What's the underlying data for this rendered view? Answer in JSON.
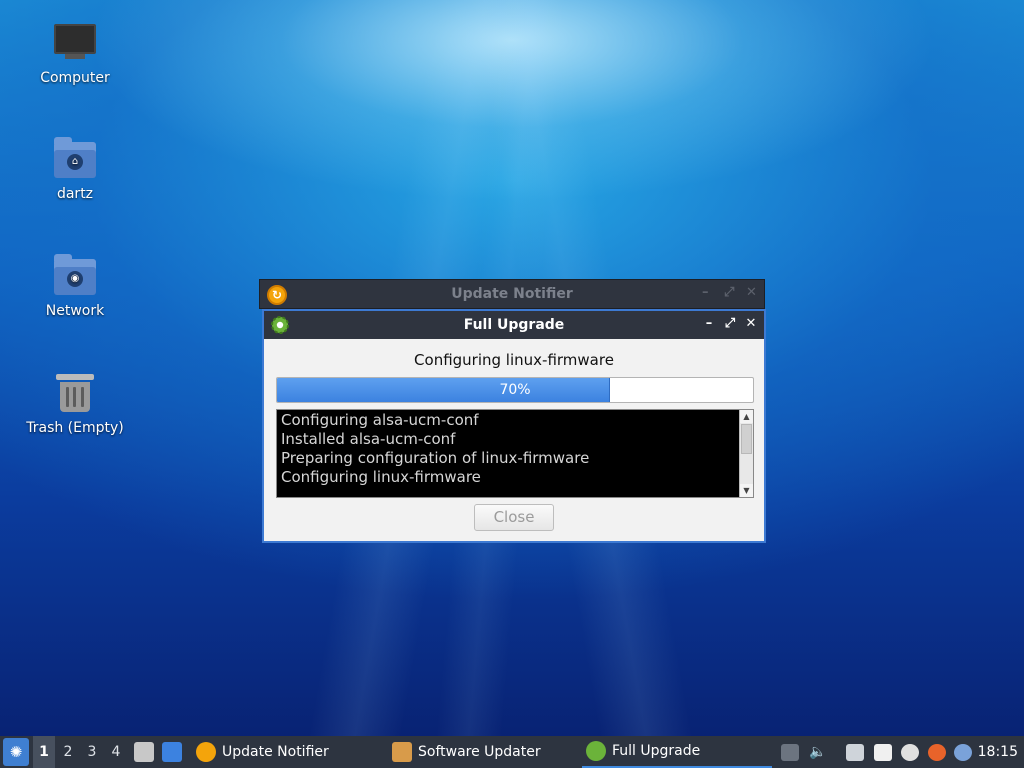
{
  "desktop": {
    "icons": [
      {
        "label": "Computer",
        "icon": "computer-icon"
      },
      {
        "label": "dartz",
        "icon": "home-folder-icon"
      },
      {
        "label": "Network",
        "icon": "network-folder-icon"
      },
      {
        "label": "Trash (Empty)",
        "icon": "trash-icon"
      }
    ]
  },
  "background_window": {
    "title": "Update Notifier",
    "icon": "update-notifier-icon"
  },
  "dialog": {
    "title": "Full Upgrade",
    "icon": "gear-icon",
    "status": "Configuring linux-firmware",
    "progress": {
      "value": 70,
      "label": "70%"
    },
    "log_lines": [
      "Configuring alsa-ucm-conf",
      "Installed alsa-ucm-conf",
      "Preparing configuration of linux-firmware",
      "Configuring linux-firmware"
    ],
    "close_label": "Close",
    "close_enabled": false,
    "accent_color": "#3c82e0"
  },
  "taskbar": {
    "workspaces": [
      "1",
      "2",
      "3",
      "4"
    ],
    "active_workspace": "1",
    "tasks": [
      {
        "label": "Update Notifier",
        "icon": "update-notifier-icon",
        "active": false
      },
      {
        "label": "Software Updater",
        "icon": "software-updater-icon",
        "active": false
      },
      {
        "label": "Full Upgrade",
        "icon": "gear-icon",
        "active": true
      }
    ],
    "clock": "18:15"
  }
}
